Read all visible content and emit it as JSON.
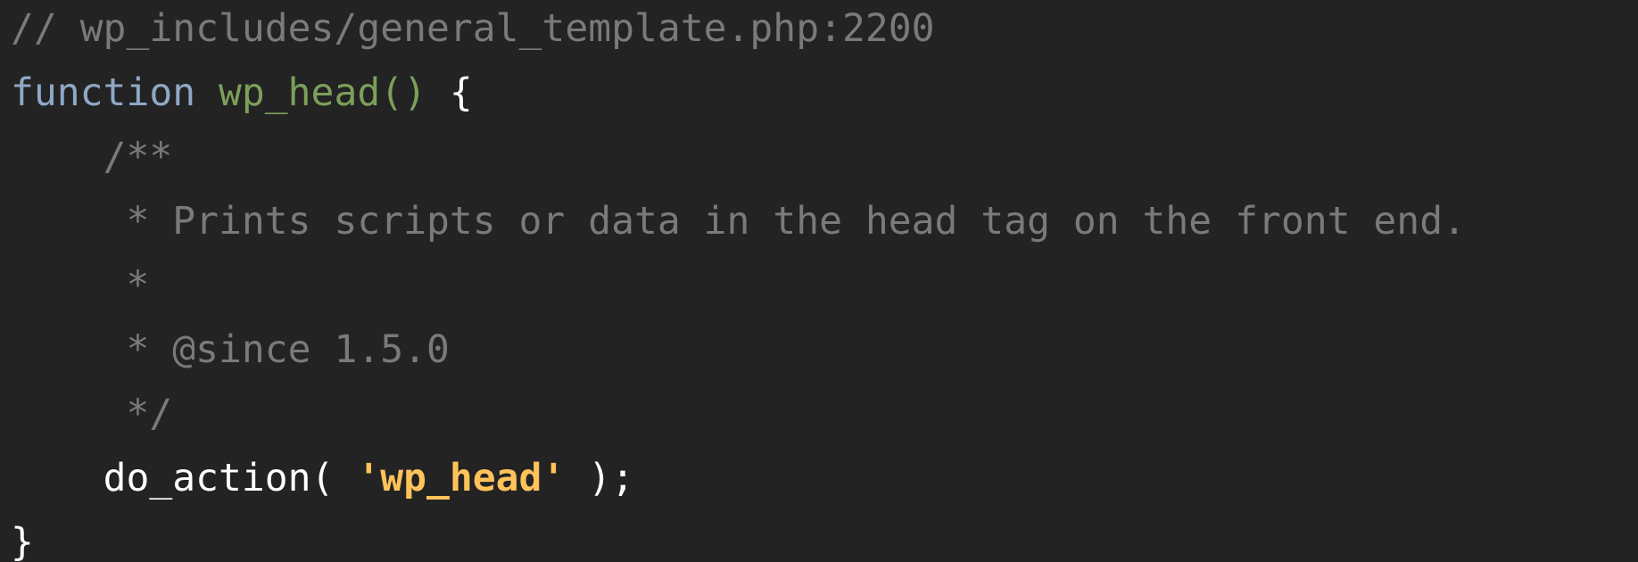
{
  "code": {
    "file_comment": "// wp_includes/general_template.php:2200",
    "keyword": "function",
    "function_name": "wp_head",
    "params": "()",
    "open_brace": "{",
    "indent": "    ",
    "doc_open": "/**",
    "doc_desc": " * Prints scripts or data in the head tag on the front end.",
    "doc_blank": " *",
    "doc_since": " * @since 1.5.0",
    "doc_close": " */",
    "call_name": "do_action(",
    "call_arg": "'wp_head'",
    "call_end": " );",
    "close_brace": "}"
  },
  "colors": {
    "background": "#232323",
    "comment": "#7a7a7a",
    "keyword": "#8fa8c6",
    "function": "#7ca05a",
    "string": "#ffc35a",
    "text": "#ffffff"
  }
}
